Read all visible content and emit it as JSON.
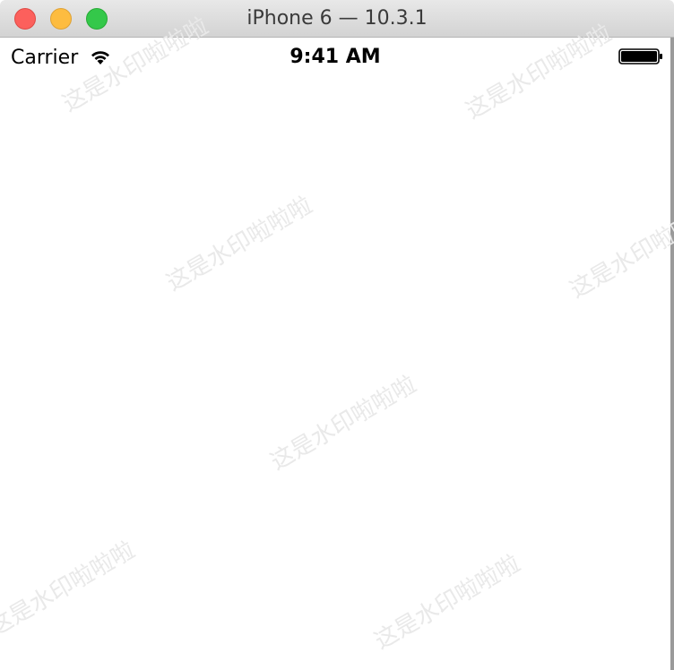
{
  "window": {
    "title": "iPhone 6 — 10.3.1",
    "controls": [
      "close",
      "minimize",
      "zoom"
    ]
  },
  "status_bar": {
    "carrier": "Carrier",
    "wifi_icon": "wifi-icon",
    "time": "9:41 AM",
    "battery_icon": "battery-icon"
  },
  "watermark": {
    "text": "这是水印啦啦啦"
  },
  "colors": {
    "close": "#fc605c",
    "minimize": "#fdbc40",
    "zoom": "#34c84a",
    "background": "#ffffff",
    "watermark": "#e9e9e9"
  }
}
